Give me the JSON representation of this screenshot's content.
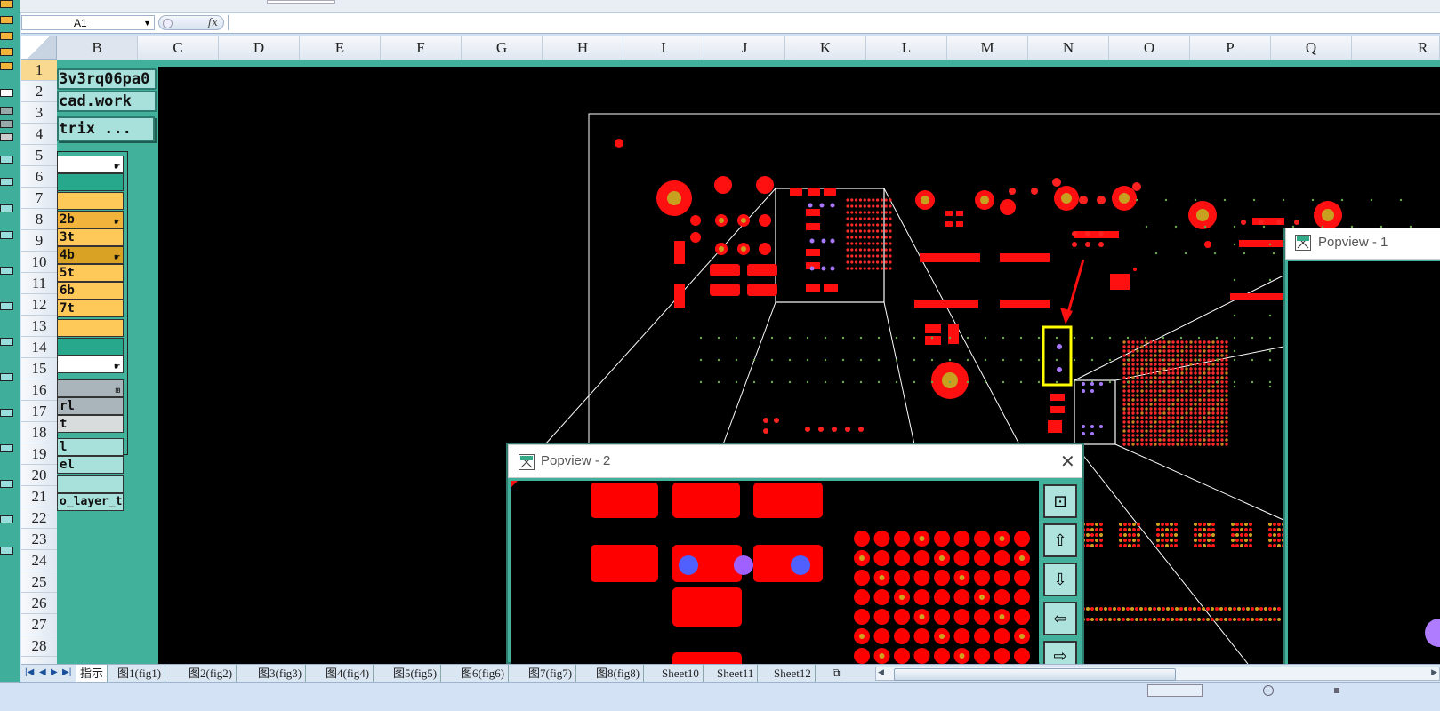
{
  "formula_bar": {
    "name_box": "A1",
    "fx": "fx",
    "formula": ""
  },
  "columns": [
    "B",
    "C",
    "D",
    "E",
    "F",
    "G",
    "H",
    "I",
    "J",
    "K",
    "L",
    "M",
    "N",
    "O",
    "P",
    "Q",
    "R"
  ],
  "rows": [
    "1",
    "2",
    "3",
    "4",
    "5",
    "6",
    "7",
    "8",
    "9",
    "10",
    "11",
    "12",
    "13",
    "14",
    "15",
    "16",
    "17",
    "18",
    "19",
    "20",
    "21",
    "22",
    "23",
    "24",
    "25",
    "26",
    "27",
    "28"
  ],
  "left_panel": {
    "id_text": "3v3rq06pa0",
    "file_text": "cad.work",
    "matrix_button": "trix ...",
    "layers": [
      "2b",
      "3t",
      "4b",
      "5t",
      "6b",
      "7t"
    ],
    "bottom_items": [
      "rl",
      "t",
      "l",
      "el",
      "o_layer_t"
    ]
  },
  "popview1": {
    "title": "Popview - 1"
  },
  "popview2": {
    "title": "Popview - 2",
    "close": "✕"
  },
  "sheet_tabs": [
    "指示",
    "图1(fig1)",
    "图2(fig2)",
    "图3(fig3)",
    "图4(fig4)",
    "图5(fig5)",
    "图6(fig6)",
    "图7(fig7)",
    "图8(fig8)",
    "Sheet10",
    "Sheet11",
    "Sheet12"
  ],
  "colors": {
    "pcb_background": "#000000",
    "pad": "#ff0000",
    "highlight": "#ffff00",
    "via": "#b07cff",
    "grid_bg": "#41b19b"
  }
}
